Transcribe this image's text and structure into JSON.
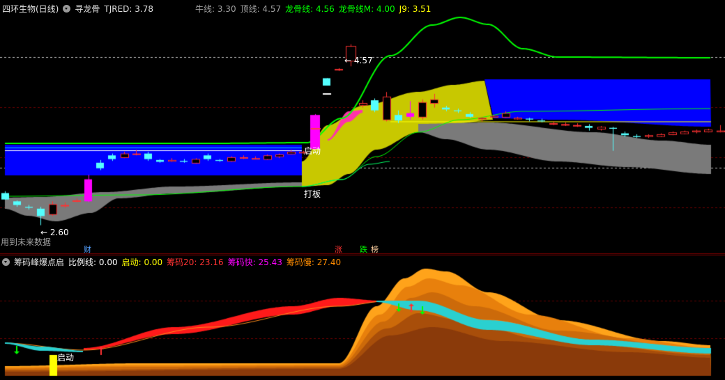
{
  "header": {
    "stock": "四环生物(日线)",
    "indicator": "寻龙骨",
    "tjred": "TJRED: 3.78",
    "niuxian": "牛线: 3.30",
    "dingxian": "顶线: 4.57",
    "longgu": "龙骨线: 4.56",
    "longgu_m": "龙骨线M: 4.00",
    "j9": "J9: 3.51"
  },
  "main": {
    "high_label": "4.57",
    "low_label": "2.60",
    "qidong_label": "启动",
    "daban_label": "打板",
    "future_note": "用到未来数据",
    "tags": {
      "cai": "财",
      "zhang": "涨",
      "die": "跌",
      "bang": "榜"
    }
  },
  "sub": {
    "indicator": "筹码峰爆点启",
    "bili": "比例线: 0.00",
    "qidong": "启动: 0.00",
    "chouma20": "筹码20: 23.16",
    "chouma_fast": "筹码快: 25.43",
    "chouma_slow": "筹码慢: 27.40",
    "qidong_label": "启动"
  },
  "colors": {
    "green": "#00ff00",
    "blue": "#0000ff",
    "olive": "#c8c800",
    "gray": "#7a7a7a",
    "magenta": "#ff00ff",
    "cyan": "#54ffff",
    "red": "#ff3232",
    "orange": "#ff8c00"
  },
  "chart_data": {
    "type": "candlestick",
    "candles": [
      {
        "o": 2.95,
        "h": 2.97,
        "l": 2.88,
        "c": 2.88
      },
      {
        "o": 2.86,
        "h": 2.87,
        "l": 2.8,
        "c": 2.82
      },
      {
        "o": 2.8,
        "h": 2.82,
        "l": 2.77,
        "c": 2.79
      },
      {
        "o": 2.78,
        "h": 2.8,
        "l": 2.6,
        "c": 2.7
      },
      {
        "o": 2.72,
        "h": 2.86,
        "l": 2.7,
        "c": 2.83
      },
      {
        "o": 2.82,
        "h": 2.85,
        "l": 2.79,
        "c": 2.82
      },
      {
        "o": 2.87,
        "h": 2.89,
        "l": 2.85,
        "c": 2.87
      },
      {
        "o": 2.86,
        "h": 3.15,
        "l": 2.85,
        "c": 3.1
      },
      {
        "o": 3.28,
        "h": 3.31,
        "l": 3.2,
        "c": 3.22
      },
      {
        "o": 3.36,
        "h": 3.38,
        "l": 3.3,
        "c": 3.32
      },
      {
        "o": 3.34,
        "h": 3.4,
        "l": 3.33,
        "c": 3.38
      },
      {
        "o": 3.38,
        "h": 3.42,
        "l": 3.36,
        "c": 3.38
      },
      {
        "o": 3.38,
        "h": 3.4,
        "l": 3.3,
        "c": 3.32
      },
      {
        "o": 3.31,
        "h": 3.32,
        "l": 3.28,
        "c": 3.29
      },
      {
        "o": 3.3,
        "h": 3.33,
        "l": 3.29,
        "c": 3.31
      },
      {
        "o": 3.3,
        "h": 3.32,
        "l": 3.28,
        "c": 3.29
      },
      {
        "o": 3.28,
        "h": 3.33,
        "l": 3.27,
        "c": 3.32
      },
      {
        "o": 3.36,
        "h": 3.38,
        "l": 3.3,
        "c": 3.32
      },
      {
        "o": 3.31,
        "h": 3.32,
        "l": 3.29,
        "c": 3.3
      },
      {
        "o": 3.3,
        "h": 3.35,
        "l": 3.29,
        "c": 3.34
      },
      {
        "o": 3.34,
        "h": 3.36,
        "l": 3.32,
        "c": 3.34
      },
      {
        "o": 3.33,
        "h": 3.35,
        "l": 3.32,
        "c": 3.33
      },
      {
        "o": 3.32,
        "h": 3.37,
        "l": 3.31,
        "c": 3.36
      },
      {
        "o": 3.35,
        "h": 3.38,
        "l": 3.33,
        "c": 3.37
      },
      {
        "o": 3.38,
        "h": 3.42,
        "l": 3.37,
        "c": 3.4
      },
      {
        "o": 3.39,
        "h": 3.41,
        "l": 3.38,
        "c": 3.4
      },
      {
        "o": 3.43,
        "h": 3.81,
        "l": 3.43,
        "c": 3.8
      },
      {
        "o": 4.2,
        "h": 4.2,
        "l": 4.12,
        "c": 4.12
      },
      {
        "o": 4.3,
        "h": 4.31,
        "l": 4.28,
        "c": 4.3
      },
      {
        "o": 4.39,
        "h": 4.57,
        "l": 4.33,
        "c": 4.55
      },
      {
        "o": 3.91,
        "h": 3.96,
        "l": 3.88,
        "c": 3.93
      },
      {
        "o": 3.96,
        "h": 3.98,
        "l": 3.83,
        "c": 3.85
      },
      {
        "o": 3.75,
        "h": 4.05,
        "l": 3.73,
        "c": 4.0
      },
      {
        "o": 3.8,
        "h": 3.85,
        "l": 3.71,
        "c": 3.74
      },
      {
        "o": 3.82,
        "h": 3.95,
        "l": 3.75,
        "c": 3.78
      },
      {
        "o": 3.78,
        "h": 3.97,
        "l": 3.75,
        "c": 3.94
      },
      {
        "o": 3.93,
        "h": 4.03,
        "l": 3.88,
        "c": 3.97
      },
      {
        "o": 3.88,
        "h": 3.9,
        "l": 3.84,
        "c": 3.86
      },
      {
        "o": 3.85,
        "h": 3.87,
        "l": 3.82,
        "c": 3.84
      },
      {
        "o": 3.81,
        "h": 3.83,
        "l": 3.77,
        "c": 3.78
      },
      {
        "o": 3.76,
        "h": 3.78,
        "l": 3.73,
        "c": 3.77
      },
      {
        "o": 3.78,
        "h": 3.8,
        "l": 3.77,
        "c": 3.79
      },
      {
        "o": 3.78,
        "h": 3.84,
        "l": 3.77,
        "c": 3.82
      },
      {
        "o": 3.76,
        "h": 3.78,
        "l": 3.75,
        "c": 3.77
      },
      {
        "o": 3.76,
        "h": 3.77,
        "l": 3.73,
        "c": 3.75
      },
      {
        "o": 3.74,
        "h": 3.76,
        "l": 3.72,
        "c": 3.73
      },
      {
        "o": 3.71,
        "h": 3.73,
        "l": 3.69,
        "c": 3.71
      },
      {
        "o": 3.7,
        "h": 3.72,
        "l": 3.68,
        "c": 3.7
      },
      {
        "o": 3.69,
        "h": 3.71,
        "l": 3.67,
        "c": 3.69
      },
      {
        "o": 3.68,
        "h": 3.7,
        "l": 3.63,
        "c": 3.66
      },
      {
        "o": 3.65,
        "h": 3.68,
        "l": 3.63,
        "c": 3.67
      },
      {
        "o": 3.66,
        "h": 3.67,
        "l": 3.41,
        "c": 3.65
      },
      {
        "o": 3.6,
        "h": 3.62,
        "l": 3.56,
        "c": 3.58
      },
      {
        "o": 3.57,
        "h": 3.59,
        "l": 3.55,
        "c": 3.56
      },
      {
        "o": 3.57,
        "h": 3.59,
        "l": 3.55,
        "c": 3.58
      },
      {
        "o": 3.57,
        "h": 3.6,
        "l": 3.56,
        "c": 3.59
      },
      {
        "o": 3.59,
        "h": 3.62,
        "l": 3.58,
        "c": 3.61
      },
      {
        "o": 3.6,
        "h": 3.63,
        "l": 3.59,
        "c": 3.62
      },
      {
        "o": 3.62,
        "h": 3.64,
        "l": 3.6,
        "c": 3.63
      },
      {
        "o": 3.62,
        "h": 3.65,
        "l": 3.61,
        "c": 3.64
      },
      {
        "o": 3.62,
        "h": 3.69,
        "l": 3.61,
        "c": 3.63
      },
      {
        "o": 3.63,
        "h": 3.64,
        "l": 3.58,
        "c": 3.58
      },
      {
        "o": 3.54,
        "h": 3.56,
        "l": 3.52,
        "c": 3.53
      },
      {
        "o": 3.52,
        "h": 3.54,
        "l": 3.5,
        "c": 3.51
      },
      {
        "o": 3.52,
        "h": 3.54,
        "l": 3.5,
        "c": 3.52
      },
      {
        "o": 3.51,
        "h": 3.53,
        "l": 3.48,
        "c": 3.49
      }
    ],
    "main_ylim": [
      2.4,
      4.9
    ],
    "yellow_line": 3.73,
    "green_line": 4.56
  }
}
